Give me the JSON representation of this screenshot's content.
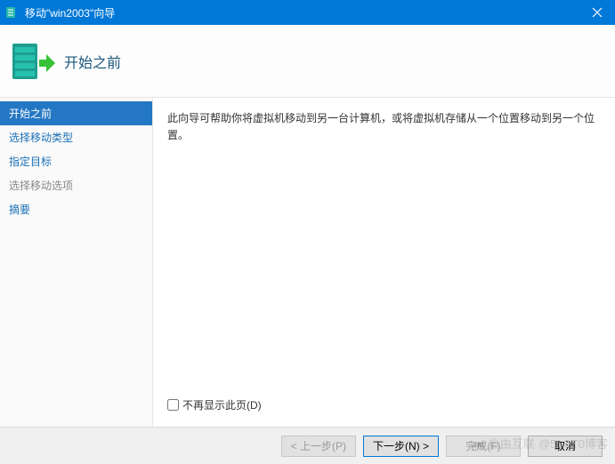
{
  "titlebar": {
    "title": "移动\"win2003\"向导"
  },
  "header": {
    "title": "开始之前"
  },
  "sidebar": {
    "items": [
      {
        "label": "开始之前",
        "state": "active"
      },
      {
        "label": "选择移动类型",
        "state": "link"
      },
      {
        "label": "指定目标",
        "state": "link"
      },
      {
        "label": "选择移动选项",
        "state": "disabled"
      },
      {
        "label": "摘要",
        "state": "link"
      }
    ]
  },
  "main": {
    "intro": "此向导可帮助你将虚拟机移动到另一台计算机，或将虚拟机存储从一个位置移动到另一个位置。",
    "dont_show_label": "不再显示此页(D)"
  },
  "footer": {
    "prev": "< 上一步(P)",
    "next": "下一步(N) >",
    "finish": "完成(F)",
    "cancel": "取消"
  },
  "watermark": {
    "brand": "自由互联",
    "text": "@51CT0博客"
  }
}
